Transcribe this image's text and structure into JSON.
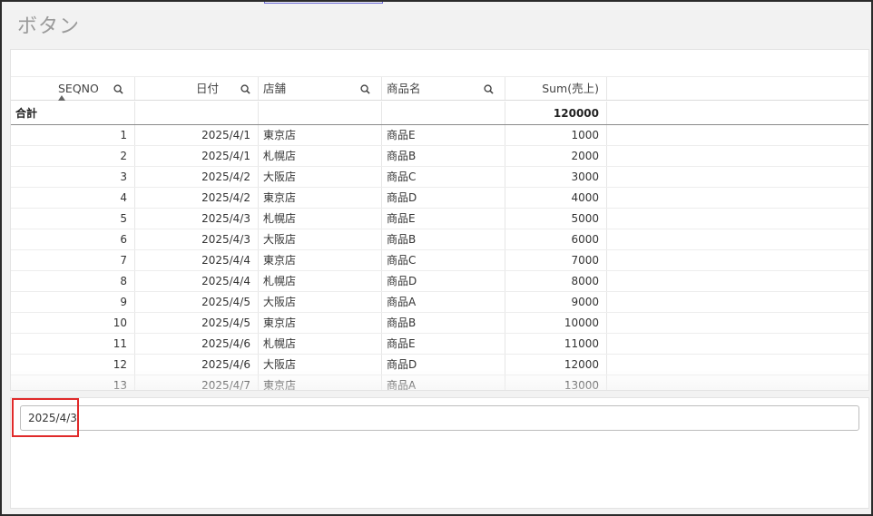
{
  "page": {
    "title": "ボタン"
  },
  "table": {
    "columns": [
      {
        "label": "SEQNO",
        "search": true,
        "sorted": "ascending"
      },
      {
        "label": "日付",
        "search": true
      },
      {
        "label": "店舗",
        "search": true
      },
      {
        "label": "商品名",
        "search": true
      },
      {
        "label": "Sum(売上)",
        "search": false
      }
    ],
    "total": {
      "label": "合計",
      "sales": "120000"
    },
    "rows": [
      {
        "seq": "1",
        "date": "2025/4/1",
        "store": "東京店",
        "product": "商品E",
        "sales": "1000"
      },
      {
        "seq": "2",
        "date": "2025/4/1",
        "store": "札幌店",
        "product": "商品B",
        "sales": "2000"
      },
      {
        "seq": "3",
        "date": "2025/4/2",
        "store": "大阪店",
        "product": "商品C",
        "sales": "3000"
      },
      {
        "seq": "4",
        "date": "2025/4/2",
        "store": "東京店",
        "product": "商品D",
        "sales": "4000"
      },
      {
        "seq": "5",
        "date": "2025/4/3",
        "store": "札幌店",
        "product": "商品E",
        "sales": "5000"
      },
      {
        "seq": "6",
        "date": "2025/4/3",
        "store": "大阪店",
        "product": "商品B",
        "sales": "6000"
      },
      {
        "seq": "7",
        "date": "2025/4/4",
        "store": "東京店",
        "product": "商品C",
        "sales": "7000"
      },
      {
        "seq": "8",
        "date": "2025/4/4",
        "store": "札幌店",
        "product": "商品D",
        "sales": "8000"
      },
      {
        "seq": "9",
        "date": "2025/4/5",
        "store": "大阪店",
        "product": "商品A",
        "sales": "9000"
      },
      {
        "seq": "10",
        "date": "2025/4/5",
        "store": "東京店",
        "product": "商品B",
        "sales": "10000"
      },
      {
        "seq": "11",
        "date": "2025/4/6",
        "store": "札幌店",
        "product": "商品E",
        "sales": "11000"
      },
      {
        "seq": "12",
        "date": "2025/4/6",
        "store": "大阪店",
        "product": "商品D",
        "sales": "12000"
      },
      {
        "seq": "13",
        "date": "2025/4/7",
        "store": "東京店",
        "product": "商品A",
        "sales": "13000"
      }
    ]
  },
  "input": {
    "value": "2025/4/3"
  },
  "colors": {
    "highlight": "#e02a2a",
    "title": "#9a9a9a",
    "background": "#f2f2f2"
  },
  "icons": {
    "column_search": "search-icon",
    "sort": "sort-ascending-icon"
  }
}
